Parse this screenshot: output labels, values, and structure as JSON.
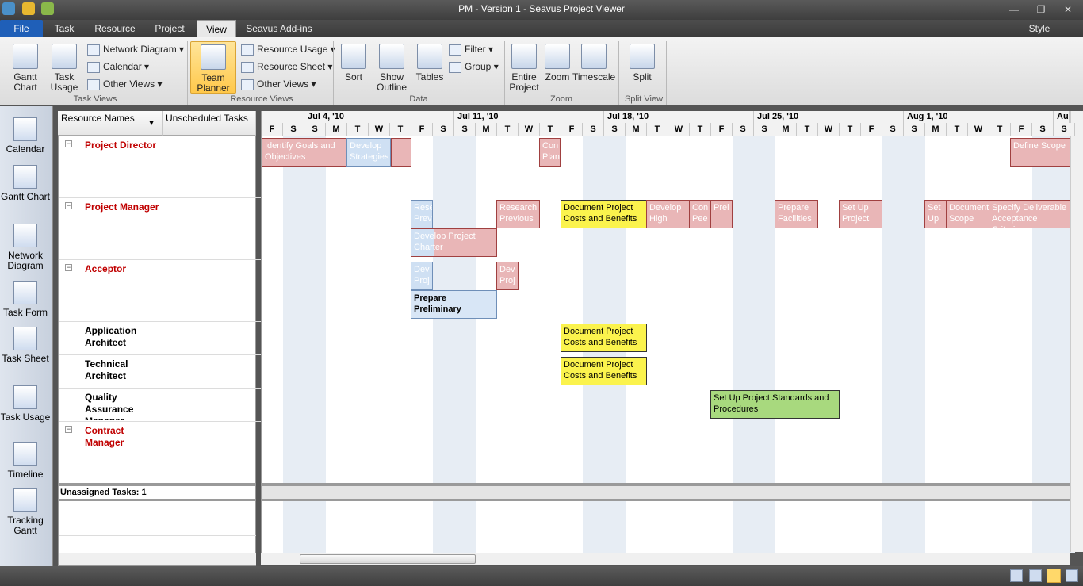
{
  "window": {
    "title": "PM - Version 1 - Seavus Project Viewer"
  },
  "tabs": [
    "File",
    "Task",
    "Resource",
    "Project",
    "View",
    "Seavus Add-ins"
  ],
  "style_menu": "Style",
  "ribbon": {
    "task_views": {
      "label": "Task Views",
      "gantt": "Gantt Chart",
      "task_usage": "Task Usage",
      "network": "Network Diagram",
      "calendar": "Calendar",
      "other": "Other Views"
    },
    "resource_views": {
      "label": "Resource Views",
      "team_planner": "Team Planner",
      "usage": "Resource Usage",
      "sheet": "Resource Sheet",
      "other": "Other Views"
    },
    "data": {
      "label": "Data",
      "sort": "Sort",
      "outline": "Show Outline",
      "tables": "Tables",
      "filter": "Filter",
      "group": "Group"
    },
    "zoom": {
      "label": "Zoom",
      "entire": "Entire Project",
      "zoom": "Zoom",
      "timescale": "Timescale"
    },
    "split": {
      "label": "Split View",
      "split": "Split"
    }
  },
  "viewbar": [
    "Calendar",
    "Gantt Chart",
    "Network Diagram",
    "Task Form",
    "Task Sheet",
    "Task Usage",
    "Timeline",
    "Tracking Gantt"
  ],
  "sheet": {
    "col_resource": "Resource Names",
    "col_unscheduled": "Unscheduled Tasks",
    "resources": [
      "Project Director",
      "Project Manager",
      "Acceptor",
      "Application Architect",
      "Technical Architect",
      "Quality Assurance Manager",
      "Contract Manager"
    ],
    "unassigned": "Unassigned Tasks: 1"
  },
  "timescale": {
    "weeks": [
      "Jul 4, '10",
      "Jul 11, '10",
      "Jul 18, '10",
      "Jul 25, '10",
      "Aug 1, '10",
      "Aug"
    ],
    "days": [
      "F",
      "S",
      "S",
      "M",
      "T",
      "W",
      "T",
      "F",
      "S",
      "S",
      "M",
      "T",
      "W",
      "T",
      "F",
      "S",
      "S",
      "M",
      "T",
      "W",
      "T",
      "F",
      "S",
      "S",
      "M",
      "T",
      "W",
      "T",
      "F",
      "S",
      "S",
      "M",
      "T",
      "W",
      "T",
      "F",
      "S",
      "S"
    ]
  },
  "tasks": {
    "t1": "Identify Goals and Objectives",
    "t2": "Develop Strategies",
    "t3": "Con Plan",
    "t4": "Define Scope",
    "t5": "Rese Prev",
    "t6": "Research Previous",
    "t7": "Document Project Costs and Benefits",
    "t8": "Develop High",
    "t9": "Con Pee",
    "t10": "Prel",
    "t11": "Prepare Facilities",
    "t12": "Set Up Project",
    "t13": "Set Up",
    "t14": "Document Scope",
    "t15": "Specify Deliverable Acceptance Criteria",
    "t16": "Develop Project Charter",
    "t17": "Dev Proj",
    "t18": "Dev Proj",
    "t19": "Prepare Preliminary",
    "t20": "Document Project Costs and Benefits",
    "t21": "Document Project Costs and Benefits",
    "t22": "Set Up Project Standards and Procedures"
  }
}
